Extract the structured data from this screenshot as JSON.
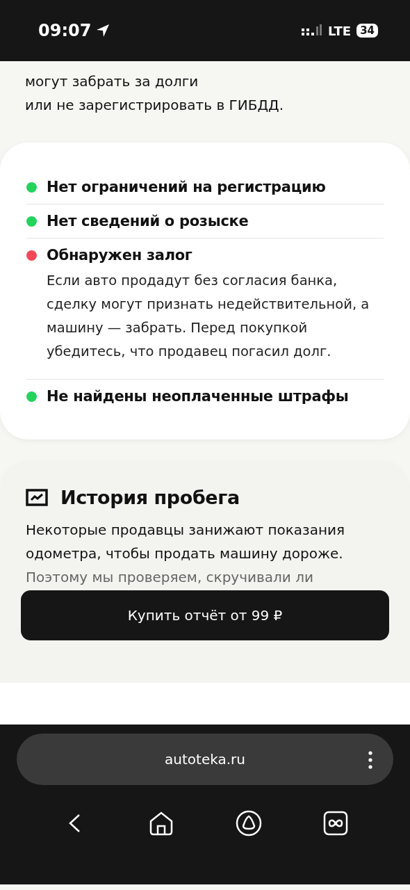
{
  "status_bar": {
    "time": "09:07",
    "network": "LTE",
    "battery": "34"
  },
  "intro": {
    "lines": [
      "могут забрать за долги",
      "или не зарегистрировать в ГИБДД."
    ]
  },
  "checks": [
    {
      "title": "Нет ограничений на регистрацию",
      "color": "#22d35c"
    },
    {
      "title": "Нет сведений о розыске",
      "color": "#22d35c"
    },
    {
      "title": "Обнаружен залог",
      "color": "#f2475a",
      "description": "Если авто продадут без согласия банка, сделку могут признать недействительной, а машину — забрать. Перед покупкой убедитесь, что продавец погасил долг."
    },
    {
      "title": "Не найдены неоплаченные штрафы",
      "color": "#22d35c"
    }
  ],
  "mileage": {
    "title": "История пробега",
    "text": "Некоторые продавцы занижают показания одометра, чтобы продать машину дороже.",
    "faded_text": "Поэтому мы проверяем, скручивали ли"
  },
  "buy_button": {
    "label": "Купить отчёт от 99 ₽"
  },
  "browser": {
    "url": "autoteka.ru"
  }
}
